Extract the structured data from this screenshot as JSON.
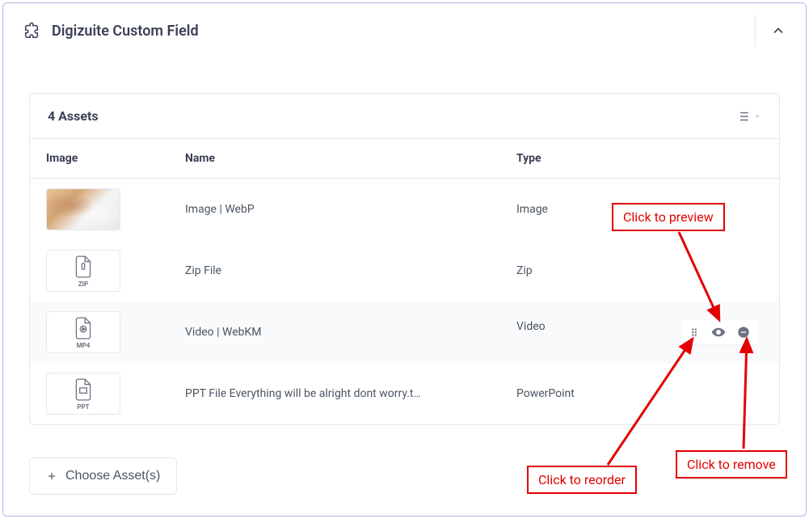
{
  "panel": {
    "title": "Digizuite Custom Field"
  },
  "assets": {
    "count_label": "4 Assets",
    "columns": {
      "image": "Image",
      "name": "Name",
      "type": "Type"
    },
    "rows": [
      {
        "name": "Image | WebP",
        "type": "Image",
        "thumb": "photo",
        "ext": ""
      },
      {
        "name": "Zip File",
        "type": "Zip",
        "thumb": "zip",
        "ext": "ZIP"
      },
      {
        "name": "Video | WebKM",
        "type": "Video",
        "thumb": "mp4",
        "ext": "MP4"
      },
      {
        "name": "PPT File Everything will be alright dont worry.t…",
        "type": "PowerPoint",
        "thumb": "ppt",
        "ext": "PPT"
      }
    ]
  },
  "choose_btn": "Choose Asset(s)",
  "annotations": {
    "preview": "Click to preview",
    "reorder": "Click to reorder",
    "remove": "Click to remove"
  }
}
